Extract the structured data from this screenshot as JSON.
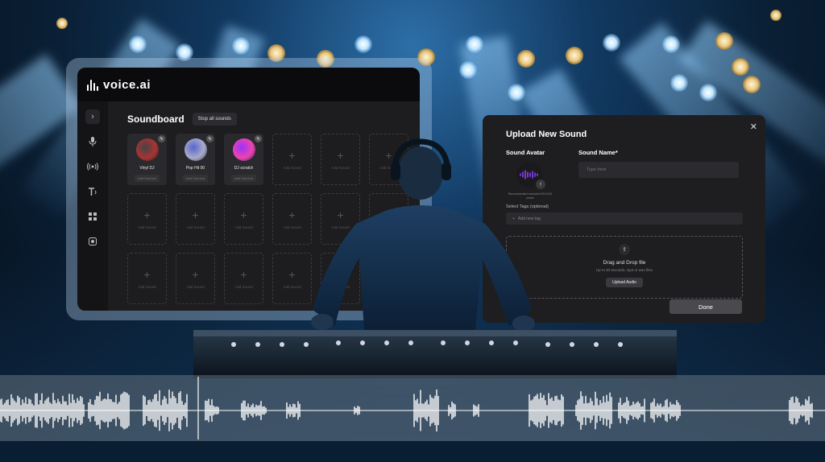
{
  "brand": {
    "name": "voice.ai"
  },
  "sidebar": {
    "items": [
      {
        "icon": "chevron-right-icon",
        "glyph": "›"
      },
      {
        "icon": "microphone-icon",
        "glyph": "🎙"
      },
      {
        "icon": "broadcast-icon",
        "glyph": "((·))"
      },
      {
        "icon": "text-to-speech-icon",
        "glyph": "T"
      },
      {
        "icon": "apps-grid-icon",
        "glyph": "▦"
      },
      {
        "icon": "soundboard-icon",
        "glyph": "◙"
      }
    ]
  },
  "soundboard": {
    "title": "Soundboard",
    "stop_all_label": "Stop all sounds",
    "filled": [
      {
        "label": "Vinyl DJ",
        "shortcut": "Add Shortcut",
        "colors": [
          "#444",
          "#a33",
          "#222"
        ]
      },
      {
        "label": "Pop Hit 00",
        "shortcut": "Add Shortcut",
        "colors": [
          "#56c",
          "#aac",
          "#333"
        ]
      },
      {
        "label": "DJ scratch",
        "shortcut": "Add Shortcut",
        "colors": [
          "#93f",
          "#e4a",
          "#226"
        ]
      }
    ],
    "add_label": "Add Sound"
  },
  "upload_modal": {
    "title": "Upload New Sound",
    "close_glyph": "✕",
    "avatar_label": "Sound Avatar",
    "avatar_note": "Recommended resolution 512×512 pixels",
    "name_label": "Sound Name*",
    "name_placeholder": "Type here",
    "tags_label": "Select Tags (optional)",
    "tags_placeholder": "Add new tag",
    "dropzone_title": "Drag and Drop file",
    "dropzone_sub": "Up to 30 seconds, mp3 or wav files",
    "upload_button": "Upload Audio",
    "done_button": "Done"
  },
  "colors": {
    "accent_purple": "#8a3cff",
    "panel": "#1e1e21",
    "stage_blue": "#2d6fa8"
  }
}
